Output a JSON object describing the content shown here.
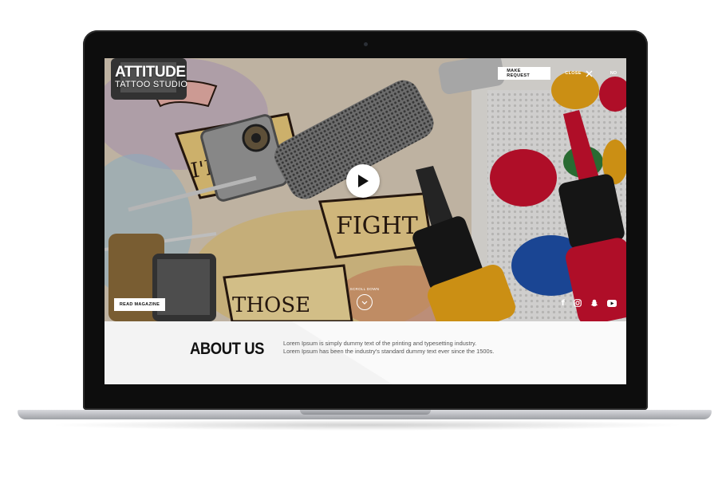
{
  "brand": {
    "name": "ATTITUDE",
    "subtitle": "TATTOO STUDIO"
  },
  "nav": {
    "make_request_label": "MAKE REQUEST",
    "close_label": "CLOSE",
    "lang_label": "NO"
  },
  "hero": {
    "banner_word_1": "FIGHT",
    "banner_word_2": "THOSE",
    "banner_word_3": "I'LL",
    "read_magazine_label": "READ MAGAZINE",
    "scroll_down_label": "SCROLL DOWN",
    "social_icons": [
      "facebook-icon",
      "instagram-icon",
      "snapchat-icon",
      "youtube-icon"
    ]
  },
  "about": {
    "title": "ABOUT US",
    "text_line_1": "Lorem Ipsum is simply dummy text of the printing and typesetting industry.",
    "text_line_2": "Lorem Ipsum has been the industry's standard dummy text ever since the 1500s."
  },
  "colors": {
    "frame": "#0d0d0d",
    "white_button": "#ffffff",
    "about_bg": "#f3f3f3",
    "ink_red": "#c8102e",
    "ink_blue": "#1e4fa8",
    "ink_yellow": "#e8a317"
  }
}
